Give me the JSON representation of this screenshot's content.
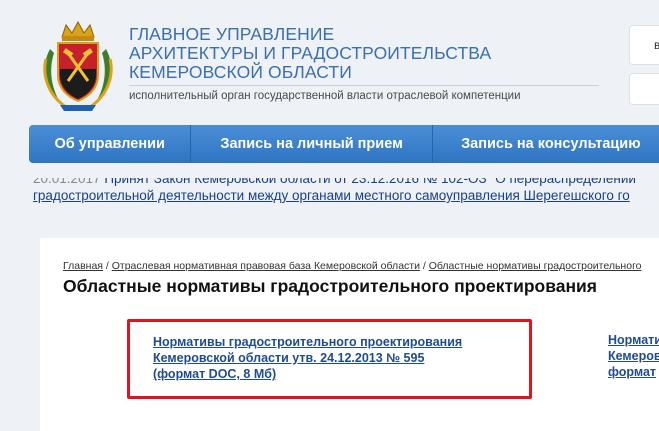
{
  "header": {
    "title_lines": [
      "ГЛАВНОЕ УПРАВЛЕНИЕ",
      "АРХИТЕКТУРЫ И ГРАДОСТРОИТЕЛЬСТВА",
      "КЕМЕРОВСКОЙ ОБЛАСТИ"
    ],
    "subtitle": "исполнительный орган государственной власти отраслевой компетенции",
    "side_box_letter": "в"
  },
  "nav": {
    "items": [
      "Об управлении",
      "Запись на личный прием",
      "Запись на консультацию"
    ]
  },
  "ticker": {
    "line1_date": "20.01.2017",
    "line1_text": "Принят Закон Кемеровской области от 23.12.2016 № 102-ОЗ \"О перераспределении",
    "line2_text": "градостроительной деятельности между органами местного самоуправления Шерегешского го"
  },
  "breadcrumbs": {
    "items": [
      "Главная",
      "Отраслевая нормативная правовая база Кемеровской области",
      "Областные нормативы градостроительного"
    ],
    "separator": "/"
  },
  "page": {
    "title": "Областные нормативы градостроительного проектирования"
  },
  "documents": {
    "main_lines": [
      "Нормативы градостроительного проектирования",
      "Кемеровской области утв. 24.12.2013 № 595",
      "(формат DOC, 8 Мб)"
    ],
    "second_lines": [
      "Норматив",
      "Кемеров",
      "формат"
    ]
  },
  "colors": {
    "nav_blue": "#2f74c2",
    "title_blue": "#3a6fb0",
    "highlight_red": "#e0141d",
    "link_blue": "#1f4b8f"
  }
}
